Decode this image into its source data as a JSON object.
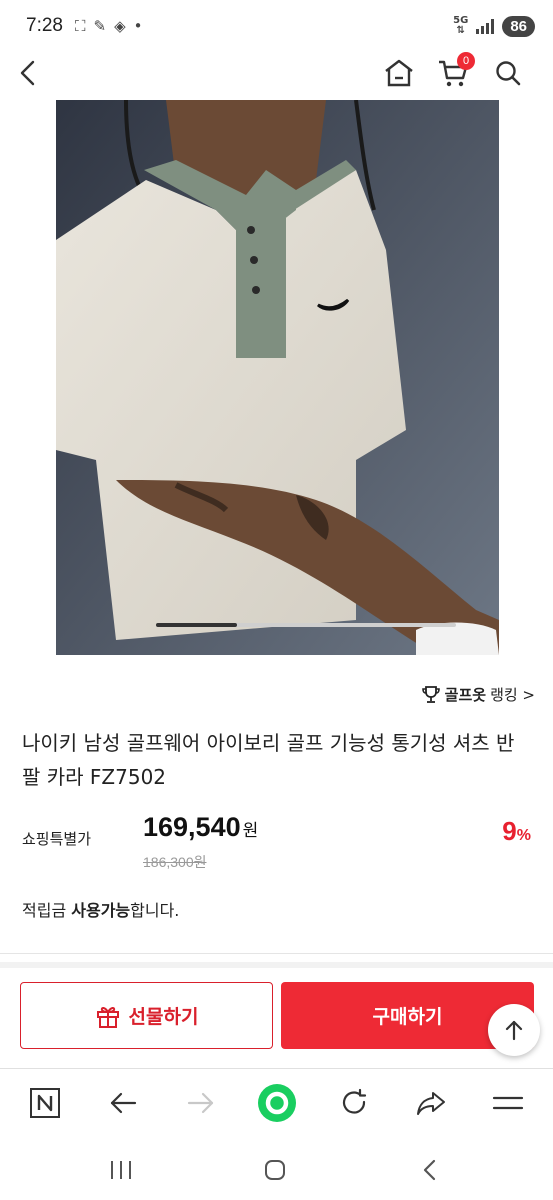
{
  "status_bar": {
    "time": "7:28",
    "network": "5G",
    "battery": "86"
  },
  "header": {
    "cart_count": "0"
  },
  "product": {
    "ranking_brand": "골프옷",
    "ranking_text": "랭킹 >",
    "title": "나이키 남성 골프웨어 아이보리 골프 기능성 통기성 셔츠 반팔 카라 FZ7502",
    "price_label": "쇼핑특별가",
    "price": "169,540",
    "price_unit": "원",
    "original_price": "186,300원",
    "discount_number": "9",
    "discount_unit": "%",
    "points_prefix": "적립금 ",
    "points_bold": "사용가능",
    "points_suffix": "합니다.",
    "image_carousel_progress": 0.27
  },
  "actions": {
    "gift_label": "선물하기",
    "buy_label": "구매하기"
  },
  "icons": [
    "back-icon",
    "home-icon",
    "cart-icon",
    "search-icon",
    "trophy-icon",
    "gift-icon",
    "arrow-up-icon",
    "naver-icon",
    "arrow-left-icon",
    "arrow-right-icon",
    "green-dot-icon",
    "refresh-icon",
    "share-icon",
    "menu-icon",
    "recents-icon",
    "home-circle-icon",
    "nav-back-icon"
  ],
  "colors": {
    "accent": "#ee2a35",
    "green": "#19ce60"
  }
}
